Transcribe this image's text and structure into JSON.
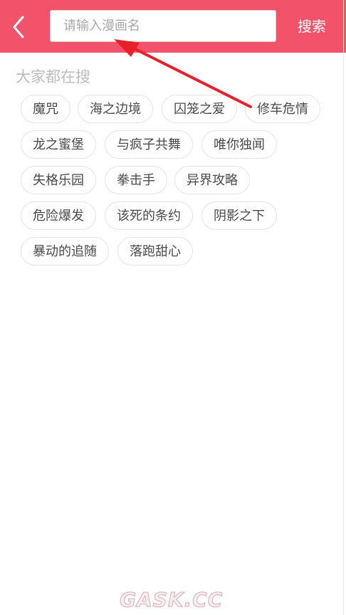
{
  "search": {
    "placeholder": "请输入漫画名",
    "button_label": "搜索"
  },
  "section": {
    "title": "大家都在搜"
  },
  "tags": [
    "魔咒",
    "海之边境",
    "囚笼之爱",
    "修车危情",
    "龙之蜜堡",
    "与疯子共舞",
    "唯你独闻",
    "失格乐园",
    "拳击手",
    "异界攻略",
    "危险爆发",
    "该死的条约",
    "阴影之下",
    "暴动的追随",
    "落跑甜心"
  ],
  "watermark": {
    "text": "GASK.CC"
  },
  "colors": {
    "header": "#f3526b",
    "annotation_arrow": "#e8202a",
    "tag_border": "#e4e4e4",
    "section_title": "#bdbdbd"
  },
  "icons": {
    "back": "chevron-left-icon"
  }
}
